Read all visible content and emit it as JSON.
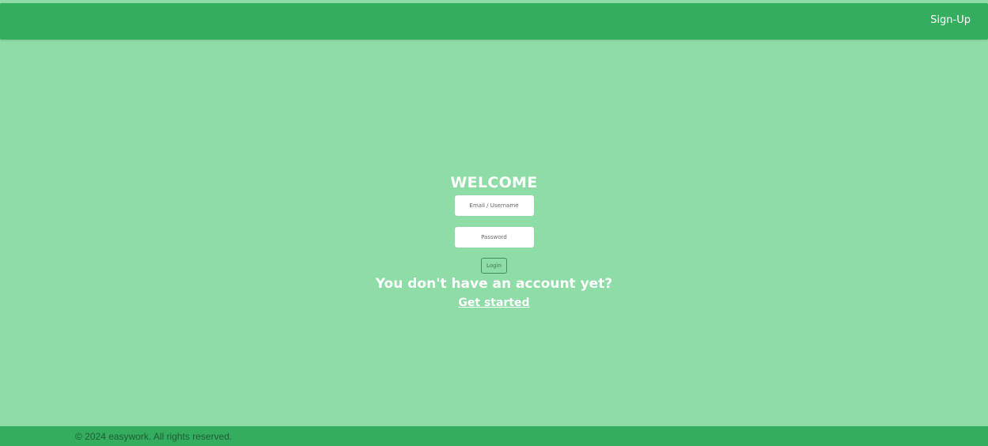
{
  "header": {
    "signup_label": "Sign-Up"
  },
  "login": {
    "title": "WELCOME",
    "email_placeholder": "Email / Username",
    "password_placeholder": "Password",
    "login_label": "Login",
    "no_account_text": "You don't have an account yet?",
    "get_started_label": "Get started"
  },
  "footer": {
    "copyright": "© 2024 easywork. All rights reserved."
  },
  "colors": {
    "background": "#8edca6",
    "bar": "#34ad5e",
    "text_light": "#ffffff"
  }
}
